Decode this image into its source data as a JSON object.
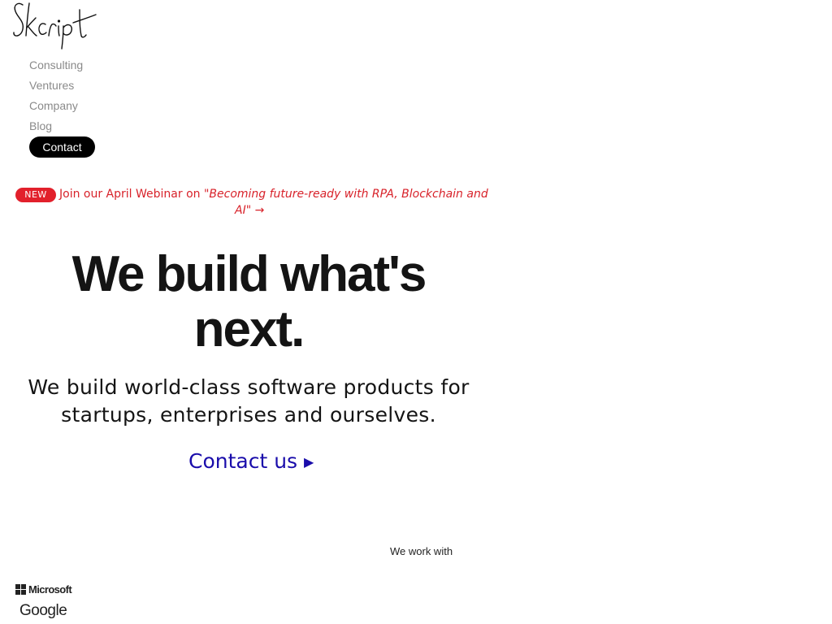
{
  "brand": {
    "logo_text": "Skcript",
    "logo_icon": "signature-logo"
  },
  "nav": {
    "items": [
      {
        "label": "Consulting"
      },
      {
        "label": "Ventures"
      },
      {
        "label": "Company"
      },
      {
        "label": "Blog"
      }
    ],
    "contact_label": "Contact"
  },
  "announcement": {
    "badge": "NEW",
    "prefix": "Join our April Webinar on ",
    "title_part1": "\"Becoming future-ready with RPA, Blockchain and",
    "title_part2": "AI\"",
    "arrow": "→"
  },
  "hero": {
    "title_line1": "We build what's",
    "title_line2": "next.",
    "subtitle_line1": "We build world-class software products for",
    "subtitle_line2": "startups, enterprises and ourselves.",
    "cta_label": "Contact us",
    "cta_icon": "play-triangle-icon",
    "cta_arrow": "▶"
  },
  "clients": {
    "heading": "We work with",
    "logos": [
      {
        "name": "Microsoft",
        "icon": "microsoft-logo"
      },
      {
        "name": "Google",
        "icon": "google-logo"
      }
    ]
  },
  "colors": {
    "accent_red": "#e2202b",
    "link_blue": "#1a0dab",
    "text_dark": "#141414",
    "nav_gray": "#8a8a8a"
  }
}
